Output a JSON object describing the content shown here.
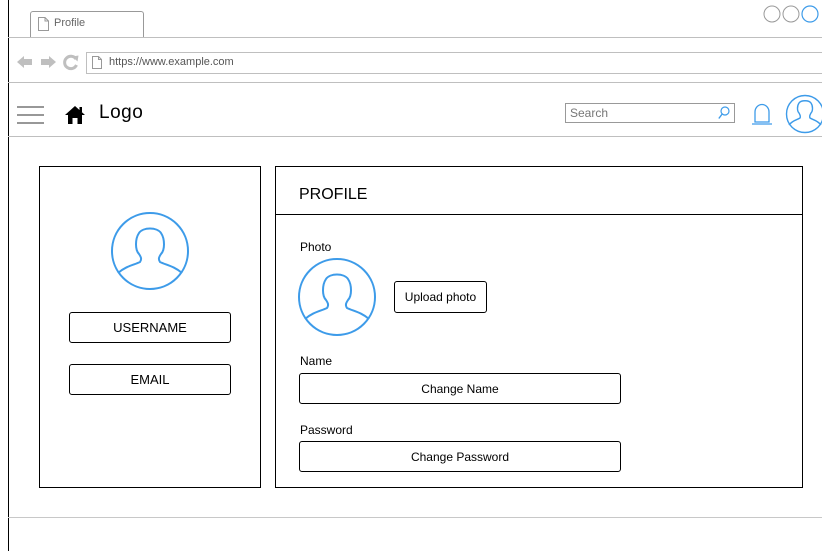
{
  "browser": {
    "tab_label": "Profile",
    "url": "https://www.example.com"
  },
  "header": {
    "logo": "Logo",
    "search_placeholder": "Search"
  },
  "sidebar": {
    "username_label": "USERNAME",
    "email_label": "EMAIL"
  },
  "profile": {
    "title": "PROFILE",
    "photo_label": "Photo",
    "upload_button": "Upload photo",
    "name_label": "Name",
    "change_name_button": "Change Name",
    "password_label": "Password",
    "change_password_button": "Change Password"
  },
  "colors": {
    "accent": "#3d9be9",
    "border": "#000000",
    "nav_icon": "#bfbfbf"
  }
}
